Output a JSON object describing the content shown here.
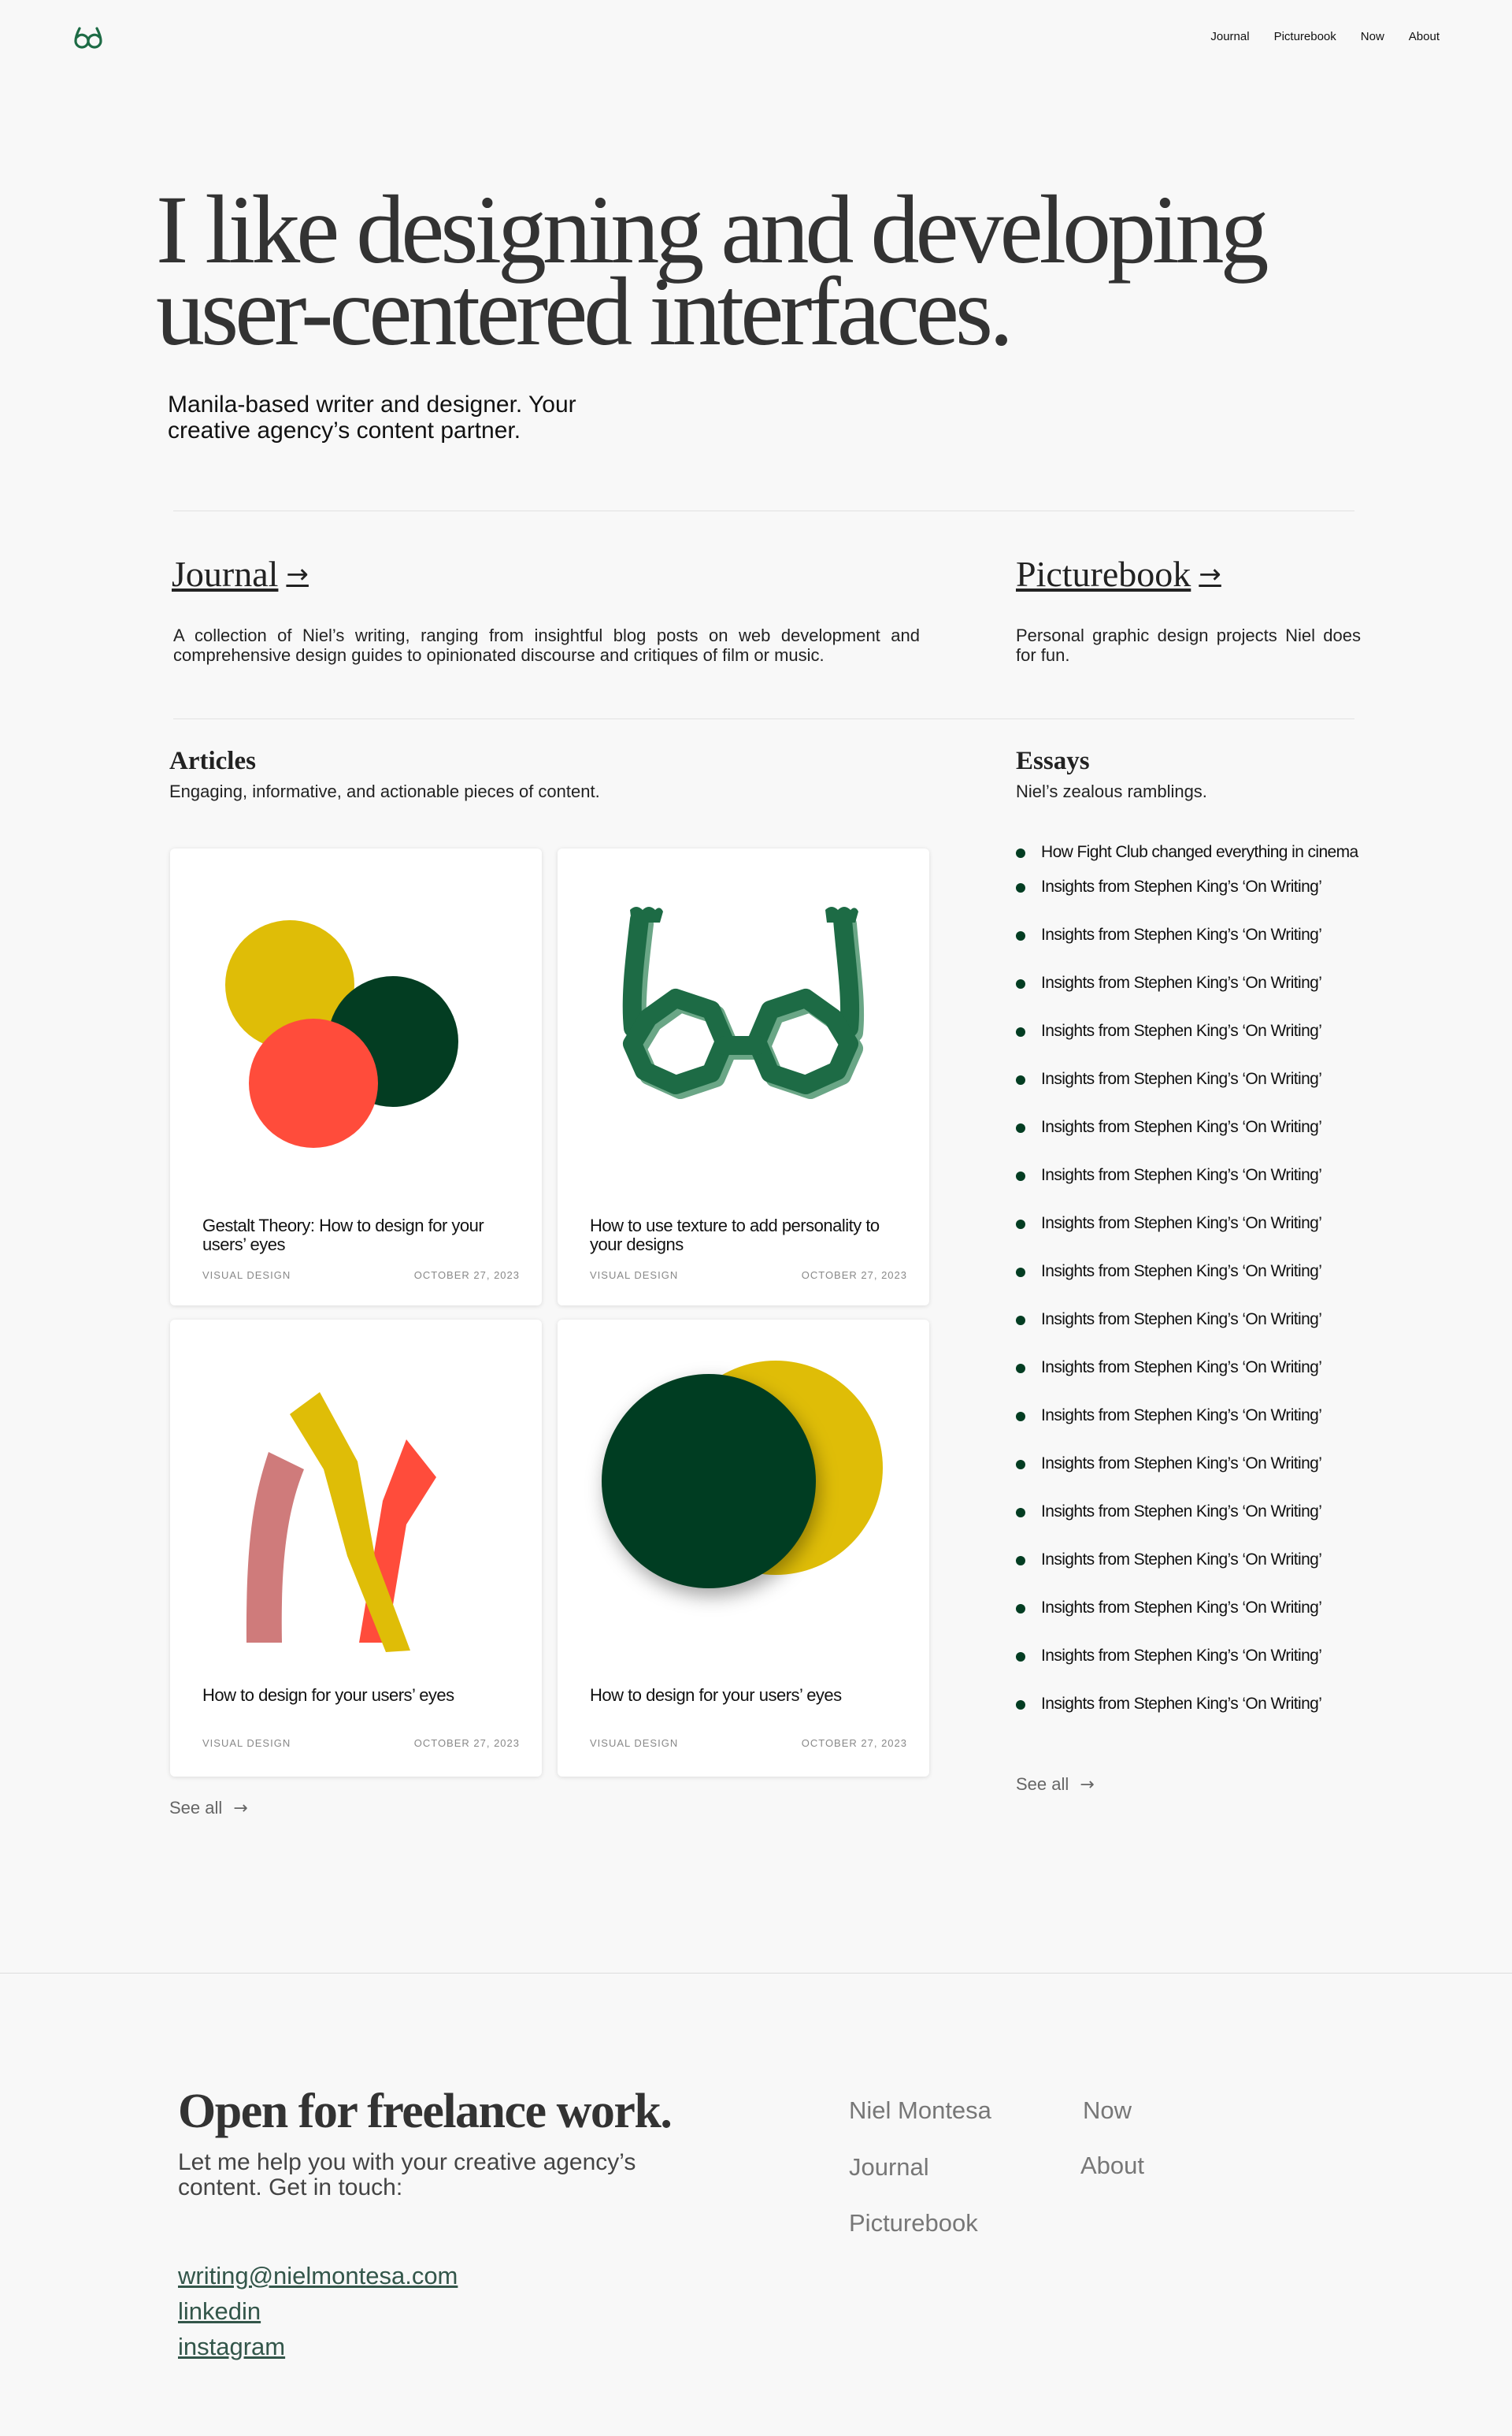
{
  "nav": {
    "logo_icon": "glasses-logo-icon",
    "items": [
      {
        "label": "Journal"
      },
      {
        "label": "Picturebook"
      },
      {
        "label": "Now"
      },
      {
        "label": "About"
      }
    ]
  },
  "hero": {
    "title_line1": "I like designing and developing",
    "title_line2": "user-centered interfaces.",
    "subtitle": "Manila-based writer and designer. Your creative agency’s content partner."
  },
  "journal": {
    "heading": "Journal",
    "arrow": "→",
    "description": "A collection of Niel’s writing, ranging from insightful blog posts on web development and comprehensive design guides to opinionated discourse and critiques of film or music."
  },
  "picturebook": {
    "heading": "Picturebook",
    "arrow": "→",
    "description": "Personal graphic design projects Niel does for fun."
  },
  "articles": {
    "heading": "Articles",
    "description": "Engaging, informative, and actionable pieces of content.",
    "cards": [
      {
        "title": "Gestalt Theory: How to design for your users’ eyes",
        "tag": "VISUAL DESIGN",
        "date": "OCTOBER 27, 2023",
        "art": "overlapping-circles"
      },
      {
        "title": "How to use texture to add personality to your designs",
        "tag": "VISUAL DESIGN",
        "date": "OCTOBER 27, 2023",
        "art": "glasses"
      },
      {
        "title": "How to design for your users’ eyes",
        "tag": "VISUAL DESIGN",
        "date": "OCTOBER 27, 2023",
        "art": "abstract-strokes"
      },
      {
        "title": "How to design for your users’ eyes",
        "tag": "VISUAL DESIGN",
        "date": "OCTOBER 27, 2023",
        "art": "shadowed-circles"
      }
    ],
    "see_all": "See all",
    "see_all_arrow": "→"
  },
  "essays": {
    "heading": "Essays",
    "description": "Niel’s zealous ramblings.",
    "items": [
      "How Fight Club changed everything in cinema",
      "Insights from Stephen King’s ‘On Writing’",
      "Insights from Stephen King’s ‘On Writing’",
      "Insights from Stephen King’s ‘On Writing’",
      "Insights from Stephen King’s ‘On Writing’",
      "Insights from Stephen King’s ‘On Writing’",
      "Insights from Stephen King’s ‘On Writing’",
      "Insights from Stephen King’s ‘On Writing’",
      "Insights from Stephen King’s ‘On Writing’",
      "Insights from Stephen King’s ‘On Writing’",
      "Insights from Stephen King’s ‘On Writing’",
      "Insights from Stephen King’s ‘On Writing’",
      "Insights from Stephen King’s ‘On Writing’",
      "Insights from Stephen King’s ‘On Writing’",
      "Insights from Stephen King’s ‘On Writing’",
      "Insights from Stephen King’s ‘On Writing’",
      "Insights from Stephen King’s ‘On Writing’",
      "Insights from Stephen King’s ‘On Writing’",
      "Insights from Stephen King’s ‘On Writing’"
    ],
    "see_all": "See all",
    "see_all_arrow": "→"
  },
  "footer": {
    "title": "Open for freelance work.",
    "subtitle": "Let me help you with your creative agency’s content. Get in touch:",
    "links": {
      "email": "writing@nielmontesa.com",
      "linkedin": "linkedin",
      "instagram": "instagram"
    },
    "nav_col1": [
      "Niel Montesa",
      "Journal",
      "Picturebook"
    ],
    "nav_col2": [
      "Now",
      "About"
    ]
  },
  "colors": {
    "background": "#f8f8f8",
    "brand_green": "#033d22",
    "accent_yellow": "#dfbd07",
    "accent_red": "#ff4c3b",
    "glasses_green": "#1d6b45",
    "link_green": "#33564a"
  }
}
